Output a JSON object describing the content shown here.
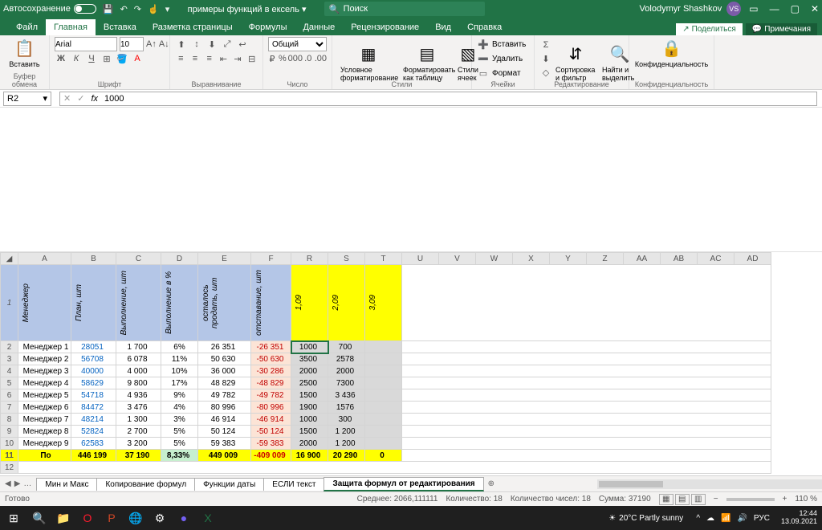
{
  "title": {
    "autosave": "Автосохранение",
    "doc": "примеры функций в ексель ▾",
    "search": "Поиск",
    "user": "Volodymyr Shashkov",
    "initials": "VS"
  },
  "menutabs": [
    "Файл",
    "Главная",
    "Вставка",
    "Разметка страницы",
    "Формулы",
    "Данные",
    "Рецензирование",
    "Вид",
    "Справка"
  ],
  "share": "Поделиться",
  "comments": "Примечания",
  "ribbon": {
    "clipboard": {
      "paste": "Вставить",
      "label": "Буфер обмена"
    },
    "font": {
      "name": "Arial",
      "size": "10",
      "label": "Шрифт"
    },
    "align": {
      "label": "Выравнивание"
    },
    "number": {
      "format": "Общий",
      "label": "Число"
    },
    "styles": {
      "cond": "Условное форматирование",
      "table": "Форматировать как таблицу",
      "cell": "Стили ячеек",
      "label": "Стили"
    },
    "cells": {
      "insert": "Вставить",
      "delete": "Удалить",
      "format": "Формат",
      "label": "Ячейки"
    },
    "edit": {
      "sort": "Сортировка и фильтр",
      "find": "Найти и выделить",
      "label": "Редактирование"
    },
    "priv": {
      "btn": "Конфиденциальность",
      "label": "Конфиденциальность"
    }
  },
  "namebox": "R2",
  "formula": "1000",
  "cols": [
    "A",
    "B",
    "C",
    "D",
    "E",
    "F",
    "R",
    "S",
    "T",
    "U",
    "V",
    "W",
    "X",
    "Y",
    "Z",
    "AA",
    "AB",
    "AC",
    "AD"
  ],
  "headers": [
    "Менеджер",
    "План, шт",
    "Выполнение, шт",
    "Выполнение в %",
    "осталось продать, шт",
    "отставание, шт",
    "1,09",
    "2,09",
    "3,09"
  ],
  "rows": [
    {
      "n": "2",
      "a": "Менеджер 1",
      "b": "28051",
      "c": "1 700",
      "d": "6%",
      "e": "26 351",
      "f": "-26 351",
      "r": "1000",
      "s": "700",
      "t": ""
    },
    {
      "n": "3",
      "a": "Менеджер 2",
      "b": "56708",
      "c": "6 078",
      "d": "11%",
      "e": "50 630",
      "f": "-50 630",
      "r": "3500",
      "s": "2578",
      "t": ""
    },
    {
      "n": "4",
      "a": "Менеджер 3",
      "b": "40000",
      "c": "4 000",
      "d": "10%",
      "e": "36 000",
      "f": "-30 286",
      "r": "2000",
      "s": "2000",
      "t": ""
    },
    {
      "n": "5",
      "a": "Менеджер 4",
      "b": "58629",
      "c": "9 800",
      "d": "17%",
      "e": "48 829",
      "f": "-48 829",
      "r": "2500",
      "s": "7300",
      "t": ""
    },
    {
      "n": "6",
      "a": "Менеджер 5",
      "b": "54718",
      "c": "4 936",
      "d": "9%",
      "e": "49 782",
      "f": "-49 782",
      "r": "1500",
      "s": "3 436",
      "t": ""
    },
    {
      "n": "7",
      "a": "Менеджер 6",
      "b": "84472",
      "c": "3 476",
      "d": "4%",
      "e": "80 996",
      "f": "-80 996",
      "r": "1900",
      "s": "1576",
      "t": ""
    },
    {
      "n": "8",
      "a": "Менеджер 7",
      "b": "48214",
      "c": "1 300",
      "d": "3%",
      "e": "46 914",
      "f": "-46 914",
      "r": "1000",
      "s": "300",
      "t": ""
    },
    {
      "n": "9",
      "a": "Менеджер 8",
      "b": "52824",
      "c": "2 700",
      "d": "5%",
      "e": "50 124",
      "f": "-50 124",
      "r": "1500",
      "s": "1 200",
      "t": ""
    },
    {
      "n": "10",
      "a": "Менеджер 9",
      "b": "62583",
      "c": "3 200",
      "d": "5%",
      "e": "59 383",
      "f": "-59 383",
      "r": "2000",
      "s": "1 200",
      "t": ""
    }
  ],
  "total": {
    "n": "11",
    "a": "По",
    "b": "446 199",
    "c": "37 190",
    "d": "8,33%",
    "e": "449 009",
    "f": "-409 009",
    "r": "16 900",
    "s": "20 290",
    "t": "0"
  },
  "sheets": [
    "Мин и Макс",
    "Копирование формул",
    "Функции даты",
    "ЕСЛИ текст",
    "Защита формул от редактирования"
  ],
  "status": {
    "ready": "Готово",
    "avg": "Среднее: 2066,111111",
    "cnt": "Количество: 18",
    "cntn": "Количество чисел: 18",
    "sum": "Сумма: 37190",
    "zoom": "110 %"
  },
  "taskbar": {
    "weather": "20°C  Partly sunny",
    "lang": "РУС",
    "time": "12:44",
    "date": "13.09.2021"
  }
}
